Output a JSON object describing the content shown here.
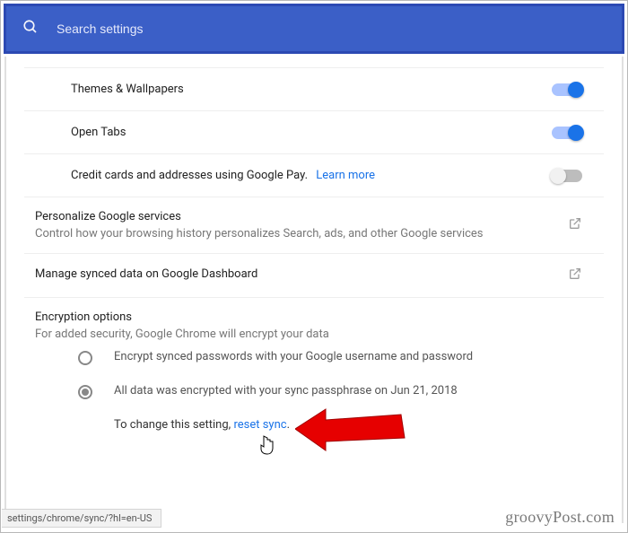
{
  "search": {
    "placeholder": "Search settings"
  },
  "rows": {
    "themes": {
      "label": "Themes & Wallpapers"
    },
    "tabs": {
      "label": "Open Tabs"
    },
    "pay": {
      "label": "Credit cards and addresses using Google Pay.",
      "link": "Learn more"
    }
  },
  "personalize": {
    "title": "Personalize Google services",
    "sub": "Control how your browsing history personalizes Search, ads, and other Google services"
  },
  "dashboard": {
    "title": "Manage synced data on Google Dashboard"
  },
  "encryption": {
    "title": "Encryption options",
    "sub": "For added security, Google Chrome will encrypt your data",
    "opt1": "Encrypt synced passwords with your Google username and password",
    "opt2": "All data was encrypted with your sync passphrase on Jun 21, 2018",
    "reset_prefix": "To change this setting, ",
    "reset_link": "reset sync",
    "reset_suffix": "."
  },
  "status": "settings/chrome/sync/?hl=en-US",
  "watermark": "groovyPost.com"
}
